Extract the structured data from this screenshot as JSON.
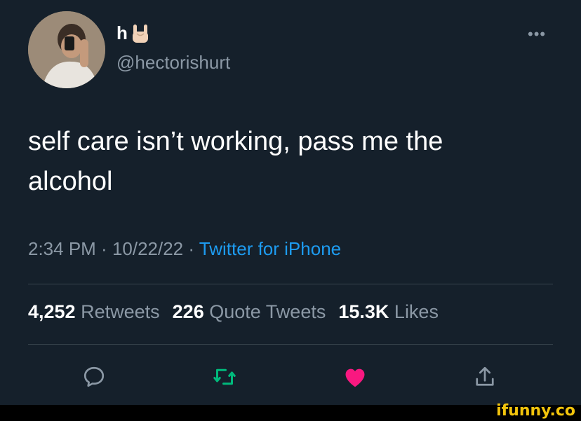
{
  "user": {
    "display_name": "h",
    "name_emoji": "rock-on-hand-icon",
    "handle": "@hectorishurt"
  },
  "more_label": "•••",
  "tweet": {
    "line1": "self care isn’t working, pass me the",
    "line2": "alcohol"
  },
  "meta": {
    "time": "2:34 PM",
    "sep1": " · ",
    "date": "10/22/22",
    "sep2": " · ",
    "source": "Twitter for iPhone"
  },
  "stats": {
    "retweets_count": "4,252",
    "retweets_label": "Retweets",
    "quotes_count": "226",
    "quotes_label": "Quote Tweets",
    "likes_count": "15.3K",
    "likes_label": "Likes"
  },
  "actions": {
    "reply_icon": "reply-icon",
    "retweet_icon": "retweet-icon",
    "like_icon": "heart-icon",
    "share_icon": "share-icon",
    "retweet_color": "#00ba7c",
    "like_color": "#f91880"
  },
  "watermark": "ifunny.co"
}
